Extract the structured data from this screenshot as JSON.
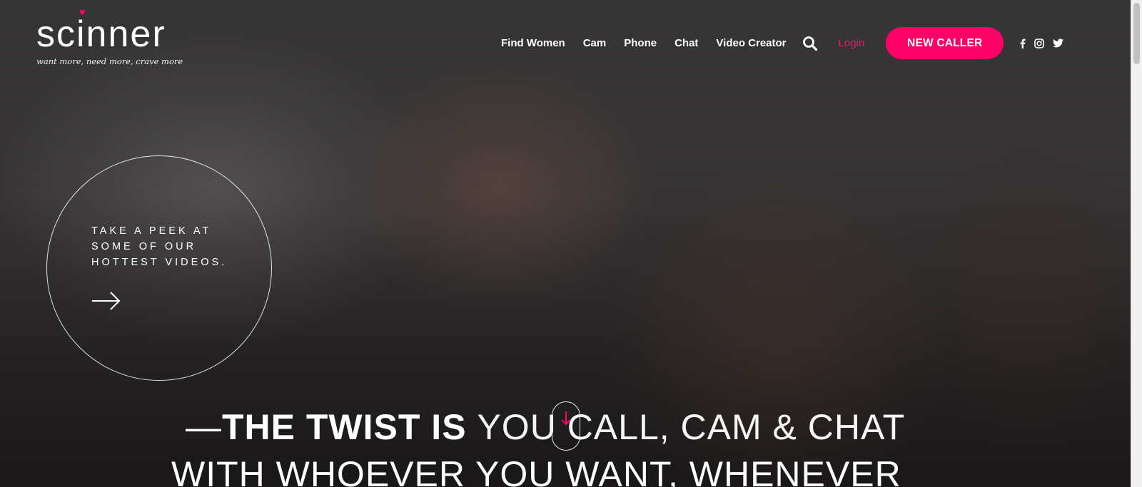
{
  "logo": {
    "wordmark": "scinner",
    "heart": "♥",
    "tagline": "want more, need more, crave more"
  },
  "nav": {
    "links": [
      "Find Women",
      "Cam",
      "Phone",
      "Chat",
      "Video Creator"
    ],
    "search_icon": "search-icon",
    "login": "Login",
    "cta": "NEW CALLER",
    "social": [
      "facebook-icon",
      "instagram-icon",
      "twitter-icon"
    ]
  },
  "peek": {
    "lines": [
      "TAKE A PEEK AT",
      "SOME OF OUR",
      "HOTTEST VIDEOS."
    ],
    "arrow_icon": "arrow-right-icon"
  },
  "headline": {
    "dash": "—",
    "bold": "THE TWIST IS",
    "light": "YOU CALL, CAM & CHAT",
    "line2": "WITH WHOEVER YOU WANT, WHENEVER"
  },
  "scroll_indicator_icon": "arrow-down-icon",
  "colors": {
    "accent": "#ff0066",
    "login": "#ff0f6b",
    "text": "#ffffff"
  }
}
